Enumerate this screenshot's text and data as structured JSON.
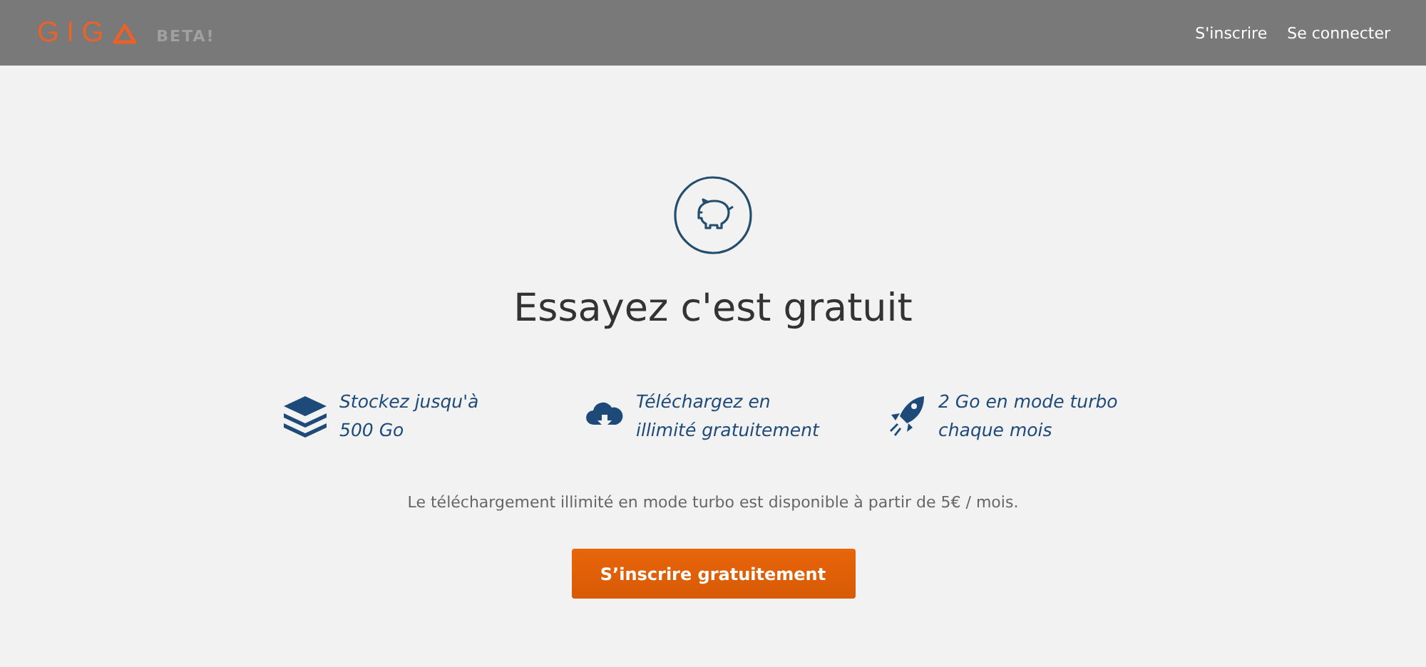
{
  "header": {
    "logo": "GIG",
    "badge": "BETA!",
    "links": [
      {
        "label": "S'inscrire"
      },
      {
        "label": "Se connecter"
      }
    ]
  },
  "hero": {
    "title": "Essayez c'est gratuit",
    "features": [
      {
        "kind": "storage",
        "lines": [
          "Stockez jusqu'à",
          "500 Go"
        ]
      },
      {
        "kind": "download",
        "lines": [
          "Téléchargez en",
          "illimité gratuitement"
        ]
      },
      {
        "kind": "turbo",
        "lines": [
          "2 Go en mode turbo",
          "chaque mois"
        ]
      }
    ],
    "note": "Le téléchargement illimité en mode turbo est disponible à partir de 5€ / mois.",
    "button": "S’inscrire gratuitement"
  }
}
